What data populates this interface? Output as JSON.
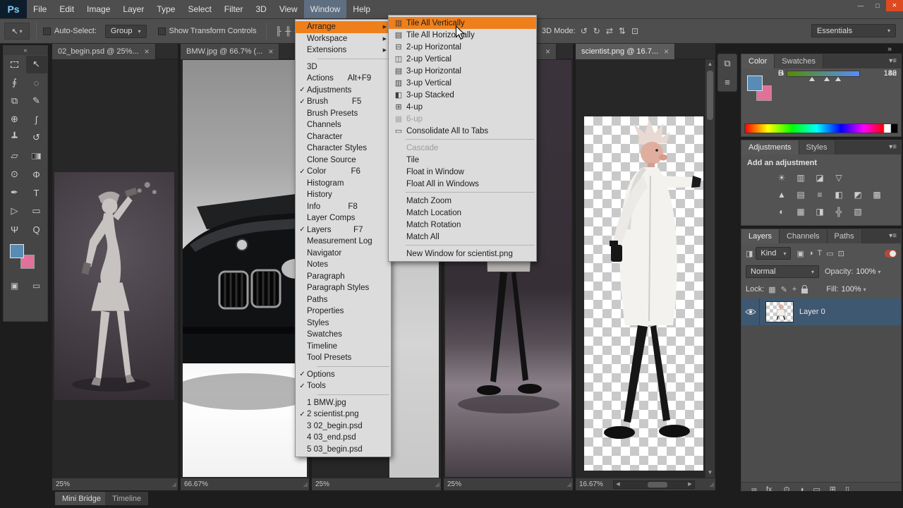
{
  "app": {
    "logo": "Ps"
  },
  "window_controls": {
    "minimize": "—",
    "restore": "□",
    "close": "×"
  },
  "colors": {
    "menu_highlight": "#ef7f1b",
    "selected_layer_row": "#3e5871",
    "foreground_color": "#568cb6",
    "background_color": "#e0719a"
  },
  "menubar": {
    "items": [
      {
        "label": "File"
      },
      {
        "label": "Edit"
      },
      {
        "label": "Image"
      },
      {
        "label": "Layer"
      },
      {
        "label": "Type"
      },
      {
        "label": "Select"
      },
      {
        "label": "Filter"
      },
      {
        "label": "3D"
      },
      {
        "label": "View"
      },
      {
        "label": "Window",
        "cls": "active"
      },
      {
        "label": "Help"
      }
    ]
  },
  "options_bar": {
    "tool_glyph": "↖",
    "auto_select_label": "Auto-Select:",
    "group_value": "Group",
    "show_transform_label": "Show Transform Controls",
    "align_icons": [
      {
        "name": "align-left-edges-icon",
        "g": "╟"
      },
      {
        "name": "align-horizontal-centers-icon",
        "g": "╫"
      },
      {
        "name": "align-right-edges-icon",
        "g": "╢"
      },
      {
        "name": "align-top-edges-icon",
        "g": "╤"
      },
      {
        "name": "align-vertical-centers-icon",
        "g": "╪"
      },
      {
        "name": "align-bottom-edges-icon",
        "g": "╧"
      }
    ],
    "mode_label": "3D Mode:",
    "mode_icons": [
      {
        "name": "orbit-3d-icon",
        "g": "↺"
      },
      {
        "name": "roll-3d-icon",
        "g": "↻"
      },
      {
        "name": "pan-3d-icon",
        "g": "⇄"
      },
      {
        "name": "slide-3d-icon",
        "g": "⇅"
      },
      {
        "name": "scale-3d-icon",
        "g": "⊡"
      }
    ],
    "workspace_value": "Essentials"
  },
  "toolbar": {
    "collapse": "«",
    "tools": [
      {
        "name": "rectangular-marquee-tool",
        "g": "",
        "cls": "marquee-tool"
      },
      {
        "name": "move-tool",
        "g": "↖",
        "cls": "pressed"
      },
      {
        "name": "lasso-tool",
        "g": "∮"
      },
      {
        "name": "quick-selection-tool",
        "g": "◌"
      },
      {
        "name": "crop-tool",
        "g": "⧉"
      },
      {
        "name": "eyedropper-tool",
        "g": "✎"
      },
      {
        "name": "healing-brush-tool",
        "g": "⊕"
      },
      {
        "name": "brush-tool",
        "g": "ʃ"
      },
      {
        "name": "clone-stamp-tool",
        "g": "┻"
      },
      {
        "name": "history-brush-tool",
        "g": "↺"
      },
      {
        "name": "eraser-tool",
        "g": "▱"
      },
      {
        "name": "gradient-tool",
        "g": "",
        "cls": "gradient-tool"
      },
      {
        "name": "blur-tool",
        "g": "⊙"
      },
      {
        "name": "dodge-tool",
        "g": "Φ"
      },
      {
        "name": "pen-tool",
        "g": "✒"
      },
      {
        "name": "type-tool",
        "g": "T"
      },
      {
        "name": "path-selection-tool",
        "g": "▷"
      },
      {
        "name": "shape-tool",
        "g": "▭"
      },
      {
        "name": "hand-tool",
        "g": "Ψ"
      },
      {
        "name": "zoom-tool",
        "g": "Q"
      }
    ],
    "extras": [
      {
        "name": "quick-mask-icon",
        "g": "▣"
      },
      {
        "name": "screen-mode-icon",
        "g": "▭"
      }
    ]
  },
  "documents": [
    {
      "tab_label": "02_begin.psd @ 25%...",
      "close": "×",
      "zoom": "25%"
    },
    {
      "tab_label": "BMW.jpg @ 66.7% (...",
      "close": "×",
      "zoom": "66.67%"
    },
    {
      "tab_label": "",
      "close": "",
      "zoom": "25%"
    },
    {
      "tab_label": "",
      "close": "×",
      "zoom": "25%"
    },
    {
      "tab_label": "scientist.png @ 16.7...",
      "close": "×",
      "zoom": "16.67%"
    }
  ],
  "dock": {
    "collapse": "»",
    "strip_icons": [
      {
        "name": "history-panel-icon",
        "g": "⧉"
      },
      {
        "name": "properties-panel-icon",
        "g": "≡"
      }
    ]
  },
  "color_panel": {
    "tabs": [
      {
        "label": "Color",
        "cls": "active"
      },
      {
        "label": "Swatches"
      }
    ],
    "menu_glyph": "▾≡",
    "channels": [
      {
        "label": "R",
        "value": "86",
        "cls": "ch-r"
      },
      {
        "label": "G",
        "value": "140",
        "cls": "ch-g"
      },
      {
        "label": "B",
        "value": "182",
        "cls": "ch-b"
      }
    ]
  },
  "adjustments_panel": {
    "tabs": [
      {
        "label": "Adjustments",
        "cls": "active"
      },
      {
        "label": "Styles"
      }
    ],
    "menu_glyph": "▾≡",
    "title": "Add an adjustment",
    "row1": [
      {
        "name": "brightness-contrast-icon",
        "g": "☀"
      },
      {
        "name": "levels-icon",
        "g": "▥"
      },
      {
        "name": "curves-icon",
        "g": "◪"
      },
      {
        "name": "exposure-icon",
        "g": "▽"
      }
    ],
    "row2": [
      {
        "name": "vibrance-icon",
        "g": "▲"
      },
      {
        "name": "hue-saturation-icon",
        "g": "▤"
      },
      {
        "name": "color-balance-icon",
        "g": "≡"
      },
      {
        "name": "black-white-icon",
        "g": "◧"
      },
      {
        "name": "photo-filter-icon",
        "g": "◩"
      },
      {
        "name": "channel-mixer-icon",
        "g": "▩"
      }
    ],
    "row3": [
      {
        "name": "invert-icon",
        "g": "◐"
      },
      {
        "name": "posterize-icon",
        "g": "▦"
      },
      {
        "name": "threshold-icon",
        "g": "◨"
      },
      {
        "name": "selective-color-icon",
        "g": "╬"
      },
      {
        "name": "gradient-map-icon",
        "g": "▧"
      }
    ]
  },
  "layers_panel": {
    "tabs": [
      {
        "label": "Layers",
        "cls": "active"
      },
      {
        "label": "Channels"
      },
      {
        "label": "Paths"
      }
    ],
    "menu_glyph": "▾≡",
    "kind_pick_glyph": "◨",
    "kind_label": "Kind",
    "filter_icons": [
      {
        "name": "filter-pixel-layers-icon",
        "g": "▣"
      },
      {
        "name": "filter-adjustment-layers-icon",
        "g": "◑"
      },
      {
        "name": "filter-type-layers-icon",
        "g": "T"
      },
      {
        "name": "filter-shape-layers-icon",
        "g": "▭"
      },
      {
        "name": "filter-smart-objects-icon",
        "g": "⊡"
      }
    ],
    "blend_mode": "Normal",
    "opacity_label": "Opacity:",
    "opacity_value": "100%",
    "lock_label": "Lock:",
    "fill_label": "Fill:",
    "fill_value": "100%",
    "layer": {
      "name": "Layer 0"
    },
    "bottom_icons": [
      {
        "name": "link-layers-icon",
        "g": "∞"
      },
      {
        "name": "layer-style-icon",
        "g": "fx."
      },
      {
        "name": "layer-mask-icon",
        "g": "⊙"
      },
      {
        "name": "adjustment-layer-icon",
        "g": "◑"
      },
      {
        "name": "new-group-icon",
        "g": "▭"
      },
      {
        "name": "new-layer-icon",
        "g": "⊞"
      },
      {
        "name": "delete-layer-icon",
        "g": "▯"
      }
    ]
  },
  "bottom_tabs": [
    {
      "label": "Mini Bridge",
      "cls": "active"
    },
    {
      "label": "Timeline"
    }
  ],
  "window_menu": {
    "items": [
      {
        "label": "Arrange",
        "arrow": "▶",
        "cls": "hl"
      },
      {
        "label": "Workspace",
        "arrow": "▶"
      },
      {
        "label": "Extensions",
        "arrow": "▶"
      },
      {
        "cls": "sep"
      },
      {
        "label": "3D"
      },
      {
        "label": "Actions",
        "shortcut": "Alt+F9"
      },
      {
        "check": "✓",
        "label": "Adjustments"
      },
      {
        "check": "✓",
        "label": "Brush",
        "shortcut": "F5"
      },
      {
        "label": "Brush Presets"
      },
      {
        "label": "Channels"
      },
      {
        "label": "Character"
      },
      {
        "label": "Character Styles"
      },
      {
        "label": "Clone Source"
      },
      {
        "check": "✓",
        "label": "Color",
        "shortcut": "F6"
      },
      {
        "label": "Histogram"
      },
      {
        "label": "History"
      },
      {
        "label": "Info",
        "shortcut": "F8"
      },
      {
        "label": "Layer Comps"
      },
      {
        "check": "✓",
        "label": "Layers",
        "shortcut": "F7"
      },
      {
        "label": "Measurement Log"
      },
      {
        "label": "Navigator"
      },
      {
        "label": "Notes"
      },
      {
        "label": "Paragraph"
      },
      {
        "label": "Paragraph Styles"
      },
      {
        "label": "Paths"
      },
      {
        "label": "Properties"
      },
      {
        "label": "Styles"
      },
      {
        "label": "Swatches"
      },
      {
        "label": "Timeline"
      },
      {
        "label": "Tool Presets"
      },
      {
        "cls": "sep"
      },
      {
        "check": "✓",
        "label": "Options"
      },
      {
        "check": "✓",
        "label": "Tools"
      },
      {
        "cls": "sep"
      },
      {
        "label": "1 BMW.jpg"
      },
      {
        "check": "✓",
        "label": "2 scientist.png"
      },
      {
        "label": "3 02_begin.psd"
      },
      {
        "label": "4 03_end.psd"
      },
      {
        "label": "5 03_begin.psd"
      }
    ]
  },
  "arrange_menu": {
    "items": [
      {
        "icon": "▥",
        "label": "Tile All Vertically",
        "cls": "hl"
      },
      {
        "icon": "▤",
        "label": "Tile All Horizontally"
      },
      {
        "icon": "⊟",
        "label": "2-up Horizontal"
      },
      {
        "icon": "◫",
        "label": "2-up Vertical"
      },
      {
        "icon": "▤",
        "label": "3-up Horizontal"
      },
      {
        "icon": "▥",
        "label": "3-up Vertical"
      },
      {
        "icon": "◧",
        "label": "3-up Stacked"
      },
      {
        "icon": "⊞",
        "label": "4-up"
      },
      {
        "icon": "▦",
        "label": "6-up",
        "cls": "disabled"
      },
      {
        "icon": "▭",
        "label": "Consolidate All to Tabs"
      },
      {
        "cls": "sep"
      },
      {
        "label": "Cascade",
        "cls": "disabled"
      },
      {
        "label": "Tile"
      },
      {
        "label": "Float in Window"
      },
      {
        "label": "Float All in Windows"
      },
      {
        "cls": "sep"
      },
      {
        "label": "Match Zoom"
      },
      {
        "label": "Match Location"
      },
      {
        "label": "Match Rotation"
      },
      {
        "label": "Match All"
      },
      {
        "cls": "sep"
      },
      {
        "label": "New Window for scientist.png"
      }
    ]
  }
}
